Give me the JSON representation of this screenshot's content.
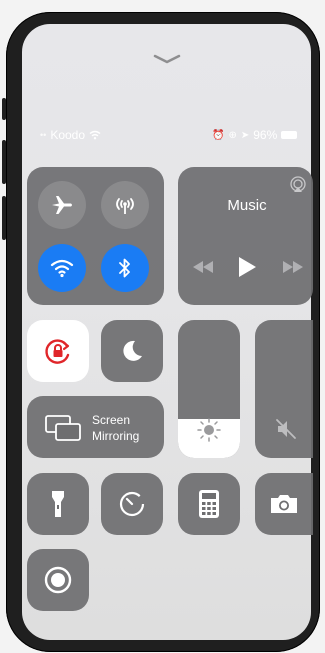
{
  "status": {
    "carrier": "Koodo",
    "battery": "96%"
  },
  "music": {
    "label": "Music"
  },
  "screen_mirroring": {
    "line1": "Screen",
    "line2": "Mirroring"
  },
  "toggles": {
    "airplane": {
      "icon": "airplane-icon",
      "state": "off"
    },
    "cellular": {
      "icon": "cellular-antenna-icon",
      "state": "off"
    },
    "wifi": {
      "icon": "wifi-icon",
      "state": "on"
    },
    "bluetooth": {
      "icon": "bluetooth-icon",
      "state": "on"
    },
    "rotation_lock": {
      "icon": "rotation-lock-icon",
      "state": "on"
    },
    "do_not_disturb": {
      "icon": "moon-icon",
      "state": "off"
    }
  },
  "sliders": {
    "brightness_level": 0.28,
    "volume_level": 0.0
  },
  "colors": {
    "accent_blue": "#1a7cf4",
    "rotation_red": "#e0262a",
    "tile_gray": "#6e6e70"
  }
}
